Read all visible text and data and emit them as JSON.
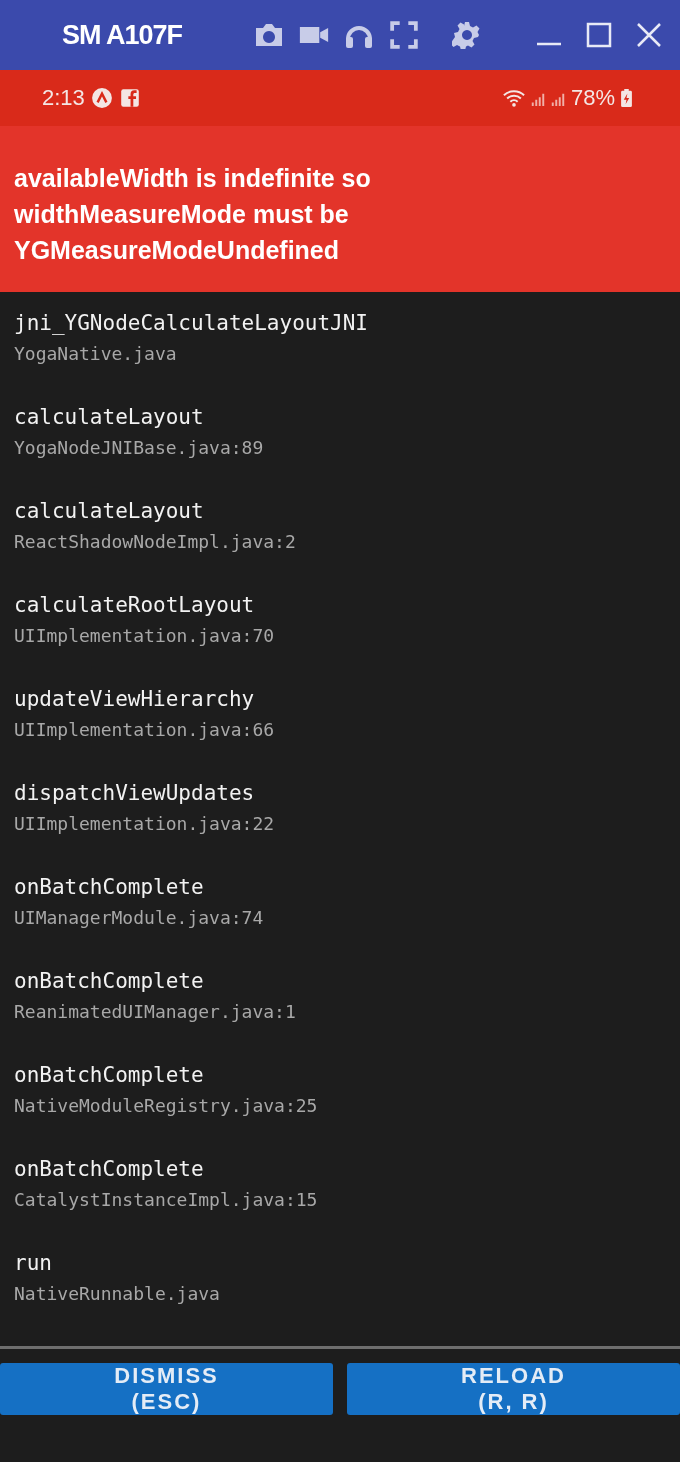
{
  "window": {
    "title": "SM A107F"
  },
  "status_bar": {
    "time": "2:13",
    "battery": "78%"
  },
  "error": {
    "message": "availableWidth is indefinite so widthMeasureMode must be YGMeasureModeUndefined"
  },
  "stack": [
    {
      "method": "jni_YGNodeCalculateLayoutJNI",
      "file": "YogaNative.java"
    },
    {
      "method": "calculateLayout",
      "file": "YogaNodeJNIBase.java:89"
    },
    {
      "method": "calculateLayout",
      "file": "ReactShadowNodeImpl.java:2"
    },
    {
      "method": "calculateRootLayout",
      "file": "UIImplementation.java:70"
    },
    {
      "method": "updateViewHierarchy",
      "file": "UIImplementation.java:66"
    },
    {
      "method": "dispatchViewUpdates",
      "file": "UIImplementation.java:22"
    },
    {
      "method": "onBatchComplete",
      "file": "UIManagerModule.java:74"
    },
    {
      "method": "onBatchComplete",
      "file": "ReanimatedUIManager.java:1"
    },
    {
      "method": "onBatchComplete",
      "file": "NativeModuleRegistry.java:25"
    },
    {
      "method": "onBatchComplete",
      "file": "CatalystInstanceImpl.java:15"
    },
    {
      "method": "run",
      "file": "NativeRunnable.java"
    }
  ],
  "buttons": [
    {
      "label": "DISMISS",
      "shortcut": "(ESC)"
    },
    {
      "label": "RELOAD",
      "shortcut": "(R, R)"
    }
  ]
}
